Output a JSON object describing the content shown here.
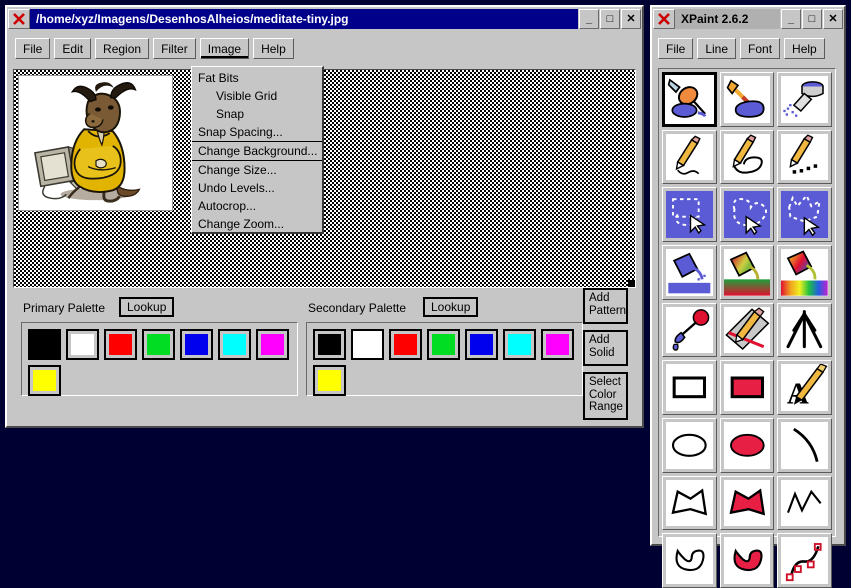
{
  "desktop": {
    "background_color": "#000033"
  },
  "main_window": {
    "title": "/home/xyz/Imagens/DesenhosAlheios/meditate-tiny.jpg",
    "active": true,
    "window_icon": "x-close-icon",
    "titlebar_buttons": [
      {
        "name": "minimize-button",
        "glyph": "_"
      },
      {
        "name": "maximize-button",
        "glyph": "□"
      },
      {
        "name": "close-button",
        "glyph": "✕"
      }
    ],
    "menubar": [
      {
        "label": "File",
        "armed": false
      },
      {
        "label": "Edit",
        "armed": false
      },
      {
        "label": "Region",
        "armed": false
      },
      {
        "label": "Filter",
        "armed": false
      },
      {
        "label": "Image",
        "armed": true
      },
      {
        "label": "Help",
        "armed": false
      }
    ],
    "canvas": {
      "image_name": "meditate-tiny.jpg",
      "image_description": "GNU gnu mascot meditating in a yellow robe beside a toppled computer monitor",
      "background_pattern": "checkerboard-dither"
    }
  },
  "image_menu": {
    "open": true,
    "items": [
      {
        "label": "Fat Bits",
        "indent": false,
        "highlighted": false
      },
      {
        "label": "Visible Grid",
        "indent": true,
        "highlighted": false
      },
      {
        "label": "Snap",
        "indent": true,
        "highlighted": false
      },
      {
        "label": "Snap Spacing...",
        "indent": false,
        "highlighted": false
      },
      {
        "label": "Change Background...",
        "indent": false,
        "highlighted": true
      },
      {
        "label": "Change Size...",
        "indent": false,
        "highlighted": false
      },
      {
        "label": "Undo Levels...",
        "indent": false,
        "highlighted": false
      },
      {
        "label": "Autocrop...",
        "indent": false,
        "highlighted": false
      },
      {
        "label": "Change Zoom...",
        "indent": false,
        "highlighted": false
      }
    ]
  },
  "palettes": {
    "primary": {
      "label": "Primary Palette",
      "lookup_label": "Lookup",
      "selected_index": 0,
      "swatches": [
        {
          "name": "black",
          "hex": "#000000"
        },
        {
          "name": "white",
          "hex": "#ffffff"
        },
        {
          "name": "red",
          "hex": "#ff0000"
        },
        {
          "name": "green",
          "hex": "#00dd22"
        },
        {
          "name": "blue",
          "hex": "#0000ee"
        },
        {
          "name": "cyan",
          "hex": "#00ffff"
        },
        {
          "name": "magenta",
          "hex": "#ff00ff"
        },
        {
          "name": "yellow",
          "hex": "#ffff00"
        }
      ]
    },
    "secondary": {
      "label": "Secondary Palette",
      "lookup_label": "Lookup",
      "selected_index": 1,
      "swatches": [
        {
          "name": "black",
          "hex": "#000000"
        },
        {
          "name": "white",
          "hex": "#ffffff"
        },
        {
          "name": "red",
          "hex": "#ff0000"
        },
        {
          "name": "green",
          "hex": "#00dd22"
        },
        {
          "name": "blue",
          "hex": "#0000ee"
        },
        {
          "name": "cyan",
          "hex": "#00ffff"
        },
        {
          "name": "magenta",
          "hex": "#ff00ff"
        },
        {
          "name": "yellow",
          "hex": "#ffff00"
        }
      ]
    },
    "side_buttons": [
      {
        "name": "add-pattern-button",
        "label": "Add\nPattern"
      },
      {
        "name": "add-solid-button",
        "label": "Add\nSolid"
      },
      {
        "name": "select-color-range-button",
        "label": "Select\nColor\nRange"
      }
    ]
  },
  "tool_window": {
    "title": "XPaint 2.6.2",
    "active": false,
    "window_icon": "x-close-icon",
    "titlebar_buttons": [
      {
        "name": "minimize-button",
        "glyph": "_"
      },
      {
        "name": "maximize-button",
        "glyph": "□"
      },
      {
        "name": "close-button",
        "glyph": "✕"
      }
    ],
    "menubar": [
      {
        "label": "File"
      },
      {
        "label": "Line"
      },
      {
        "label": "Font"
      },
      {
        "label": "Help"
      }
    ],
    "selected_tool_index": 0,
    "tools": [
      {
        "name": "paint-brush-tool",
        "icon": "fountain-pen-blob-icon"
      },
      {
        "name": "paint-blob-tool",
        "icon": "brush-blob-icon"
      },
      {
        "name": "airbrush-tool",
        "icon": "spray-can-icon"
      },
      {
        "name": "pencil-tool",
        "icon": "pencil-line-icon"
      },
      {
        "name": "pencil-loop-tool",
        "icon": "pencil-loop-icon"
      },
      {
        "name": "pencil-dots-tool",
        "icon": "pencil-dots-icon"
      },
      {
        "name": "select-rect-tool",
        "icon": "marquee-rect-icon"
      },
      {
        "name": "select-freehand-tool",
        "icon": "marquee-lasso-icon"
      },
      {
        "name": "select-polygon-tool",
        "icon": "marquee-polygon-icon"
      },
      {
        "name": "fill-solid-tool",
        "icon": "paint-bucket-icon"
      },
      {
        "name": "fill-gradient-tool",
        "icon": "paint-bucket-gradient-icon"
      },
      {
        "name": "fill-rainbow-tool",
        "icon": "paint-bucket-rainbow-icon"
      },
      {
        "name": "eyedropper-tool",
        "icon": "color-picker-icon"
      },
      {
        "name": "smear-tool",
        "icon": "ruler-pencil-icon"
      },
      {
        "name": "sharpen-tool",
        "icon": "starburst-icon"
      },
      {
        "name": "rectangle-outline-tool",
        "icon": "rectangle-outline-icon"
      },
      {
        "name": "rectangle-filled-tool",
        "icon": "rectangle-filled-icon"
      },
      {
        "name": "text-tool",
        "icon": "text-a-pen-icon"
      },
      {
        "name": "ellipse-outline-tool",
        "icon": "ellipse-outline-icon"
      },
      {
        "name": "ellipse-filled-tool",
        "icon": "ellipse-filled-icon"
      },
      {
        "name": "arc-tool",
        "icon": "arc-icon"
      },
      {
        "name": "polygon-outline-tool",
        "icon": "polygon-outline-icon"
      },
      {
        "name": "polygon-filled-tool",
        "icon": "polygon-filled-icon"
      },
      {
        "name": "polyline-tool",
        "icon": "polyline-icon"
      },
      {
        "name": "closed-curve-tool",
        "icon": "closed-curve-outline-icon"
      },
      {
        "name": "closed-curve-filled-tool",
        "icon": "closed-curve-filled-icon"
      },
      {
        "name": "bezier-curve-tool",
        "icon": "bezier-curve-icon"
      }
    ]
  }
}
